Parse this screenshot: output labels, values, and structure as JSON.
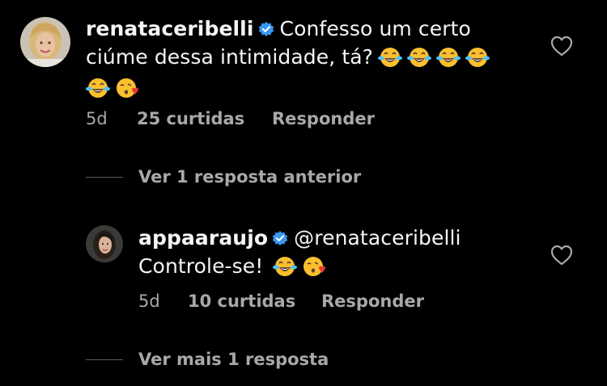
{
  "comments": [
    {
      "username": "renataceribelli",
      "verified": true,
      "text_line1": "Confesso um certo",
      "text_line2": "ciúme dessa intimidade, tá?",
      "emojis_line2": [
        "face-with-tears-of-joy",
        "face-with-tears-of-joy",
        "face-with-tears-of-joy",
        "face-with-tears-of-joy"
      ],
      "emojis_line3": [
        "face-with-tears-of-joy",
        "face-blowing-a-kiss"
      ],
      "time": "5d",
      "likes": "25 curtidas",
      "reply_label": "Responder"
    },
    {
      "username": "appaaraujo",
      "verified": true,
      "mention": "@renataceribelli",
      "text": "Controle-se!",
      "emojis": [
        "face-with-tears-of-joy",
        "face-blowing-a-kiss"
      ],
      "time": "5d",
      "likes": "10 curtidas",
      "reply_label": "Responder"
    }
  ],
  "view_previous_reply": "Ver 1 resposta anterior",
  "view_more_replies": "Ver mais 1 resposta",
  "colors": {
    "background": "#000000",
    "text": "#f5f5f5",
    "secondary": "#a8a8a8",
    "verified": "#3897f0",
    "divider": "#5c5c5c"
  },
  "icons": [
    "heart-outline-icon",
    "verified-badge-icon"
  ]
}
